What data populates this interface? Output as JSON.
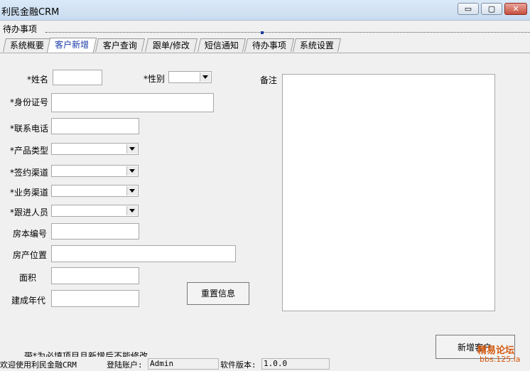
{
  "window": {
    "title": "利民金融CRM",
    "minimize": "▭",
    "maximize": "▢",
    "close": "✕"
  },
  "menu": {
    "todo": "待办事项"
  },
  "tabs": [
    "系统概要",
    "客户新增",
    "客户查询",
    "跟单/修改",
    "短信通知",
    "待办事项",
    "系统设置"
  ],
  "active_tab": "客户新增",
  "form": {
    "name_label": "*姓名",
    "gender_label": "*性别",
    "id_label": "*身份证号",
    "phone_label": "*联系电话",
    "product_label": "*产品类型",
    "channel_label": "*签约渠道",
    "biz_channel_label": "*业务渠道",
    "follower_label": "*跟进人员",
    "house_no_label": "房本编号",
    "house_loc_label": "房产位置",
    "area_label": "面积",
    "year_label": "建成年代",
    "remarks_label": "备注",
    "reset_button": "重置信息",
    "add_button": "新增客户",
    "hint": "带*为必填项目且新增后不能修改"
  },
  "status": {
    "welcome": "欢迎使用利民金融CRM",
    "account_label": "登陆账户:",
    "account_value": "Admin",
    "version_label": "软件版本:",
    "version_value": "1.0.0"
  },
  "watermark": {
    "line1": "精易论坛",
    "line2": "bbs.125.la"
  }
}
